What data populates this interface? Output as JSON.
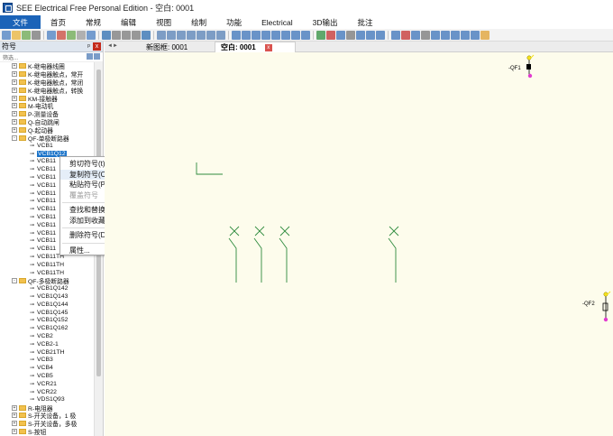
{
  "window": {
    "title": "SEE Electrical Free Personal Edition - 空白: 0001"
  },
  "menu": [
    "文件",
    "首页",
    "常规",
    "编辑",
    "视图",
    "绘制",
    "功能",
    "Electrical",
    "3D输出",
    "批注"
  ],
  "panel": {
    "title": "符号",
    "pin": "ᵖ",
    "close": "x",
    "search_placeholder": "筛选..."
  },
  "tree": [
    {
      "label": "K-继电器线圈",
      "level": 0,
      "type": "folder",
      "exp": "+"
    },
    {
      "label": "K-继电器触点，常开",
      "level": 0,
      "type": "folder",
      "exp": "+"
    },
    {
      "label": "K-继电器触点，常闭",
      "level": 0,
      "type": "folder",
      "exp": "+"
    },
    {
      "label": "K-继电器触点，转换",
      "level": 0,
      "type": "folder",
      "exp": "+"
    },
    {
      "label": "KM-接触器",
      "level": 0,
      "type": "folder",
      "exp": "+"
    },
    {
      "label": "M-电动机",
      "level": 0,
      "type": "folder",
      "exp": "+"
    },
    {
      "label": "P-测量设备",
      "level": 0,
      "type": "folder",
      "exp": "+"
    },
    {
      "label": "Q-自动跳闸",
      "level": 0,
      "type": "folder",
      "exp": "+"
    },
    {
      "label": "Q-起动器",
      "level": 0,
      "type": "folder",
      "exp": "+"
    },
    {
      "label": "QF-单极断路器",
      "level": 0,
      "type": "folder",
      "exp": "-"
    },
    {
      "label": "VCB1",
      "level": 1,
      "type": "sym"
    },
    {
      "label": "VCB1Q12",
      "level": 1,
      "type": "sym",
      "selected": true
    },
    {
      "label": "VCB11",
      "level": 1,
      "type": "sym"
    },
    {
      "label": "VCB11",
      "level": 1,
      "type": "sym"
    },
    {
      "label": "VCB11",
      "level": 1,
      "type": "sym"
    },
    {
      "label": "VCB11",
      "level": 1,
      "type": "sym"
    },
    {
      "label": "VCB11",
      "level": 1,
      "type": "sym"
    },
    {
      "label": "VCB11",
      "level": 1,
      "type": "sym"
    },
    {
      "label": "VCB11",
      "level": 1,
      "type": "sym"
    },
    {
      "label": "VCB11",
      "level": 1,
      "type": "sym"
    },
    {
      "label": "VCB11",
      "level": 1,
      "type": "sym"
    },
    {
      "label": "VCB11",
      "level": 1,
      "type": "sym"
    },
    {
      "label": "VCB11",
      "level": 1,
      "type": "sym"
    },
    {
      "label": "VCB11",
      "level": 1,
      "type": "sym"
    },
    {
      "label": "VCB11TH",
      "level": 1,
      "type": "sym"
    },
    {
      "label": "VCB11TH",
      "level": 1,
      "type": "sym"
    },
    {
      "label": "VCB11TH",
      "level": 1,
      "type": "sym"
    },
    {
      "label": "QF-多极断路器",
      "level": 0,
      "type": "folder",
      "exp": "-"
    },
    {
      "label": "VCB1Q142",
      "level": 1,
      "type": "sym"
    },
    {
      "label": "VCB1Q143",
      "level": 1,
      "type": "sym"
    },
    {
      "label": "VCB1Q144",
      "level": 1,
      "type": "sym"
    },
    {
      "label": "VCB1Q145",
      "level": 1,
      "type": "sym"
    },
    {
      "label": "VCB1Q152",
      "level": 1,
      "type": "sym"
    },
    {
      "label": "VCB1Q162",
      "level": 1,
      "type": "sym"
    },
    {
      "label": "VCB2",
      "level": 1,
      "type": "sym"
    },
    {
      "label": "VCB2-1",
      "level": 1,
      "type": "sym"
    },
    {
      "label": "VCB21TH",
      "level": 1,
      "type": "sym"
    },
    {
      "label": "VCB3",
      "level": 1,
      "type": "sym"
    },
    {
      "label": "VCB4",
      "level": 1,
      "type": "sym"
    },
    {
      "label": "VCB5",
      "level": 1,
      "type": "sym"
    },
    {
      "label": "VCR21",
      "level": 1,
      "type": "sym"
    },
    {
      "label": "VCR22",
      "level": 1,
      "type": "sym"
    },
    {
      "label": "VDS1Q93",
      "level": 1,
      "type": "sym"
    },
    {
      "label": "R-电阻器",
      "level": 0,
      "type": "folder",
      "exp": "+"
    },
    {
      "label": "S-开关设备，1 极",
      "level": 0,
      "type": "folder",
      "exp": "+"
    },
    {
      "label": "S-开关设备，多极",
      "level": 0,
      "type": "folder",
      "exp": "+"
    },
    {
      "label": "S-按钮",
      "level": 0,
      "type": "folder",
      "exp": "+"
    }
  ],
  "context_menu": [
    {
      "label": "剪切符号(t)"
    },
    {
      "label": "复制符号(C)",
      "hover": true
    },
    {
      "label": "粘贴符号(P)"
    },
    {
      "label": "覆盖符号",
      "disabled": true
    },
    {
      "sep": true
    },
    {
      "label": "查找和替换"
    },
    {
      "label": "添加到收藏夹(A)"
    },
    {
      "sep": true
    },
    {
      "label": "删除符号(D)..."
    },
    {
      "sep": true
    },
    {
      "label": "属性..."
    }
  ],
  "tabs": {
    "tab1": "新图框: 0001",
    "tab2": "空白: 0001",
    "close": "x"
  },
  "canvas": {
    "label_qf1": "-QF1",
    "label_qf2": "-QF2"
  }
}
